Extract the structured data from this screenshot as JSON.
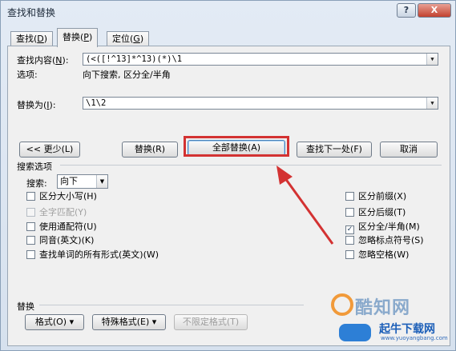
{
  "window": {
    "title": "查找和替换",
    "help_label": "?",
    "close_label": "X"
  },
  "tabs": [
    {
      "label": "查找",
      "key": "D"
    },
    {
      "label": "替换",
      "key": "P"
    },
    {
      "label": "定位",
      "key": "G"
    }
  ],
  "find": {
    "label": "查找内容",
    "key": "N",
    "value": "(<([!^13]*^13)(*)\\1",
    "options_label": "选项:",
    "options_value": "向下搜索, 区分全/半角"
  },
  "replace": {
    "label": "替换为",
    "key": "I",
    "value": "\\1\\2"
  },
  "buttons": {
    "less": "<< 更少(L)",
    "replace": "替换(R)",
    "replace_all": "全部替换(A)",
    "find_next": "查找下一处(F)",
    "cancel": "取消"
  },
  "search_options": {
    "title": "搜索选项",
    "search_label": "搜索:",
    "search_value": "向下",
    "left": [
      {
        "label": "区分大小写(H)",
        "checked": false,
        "disabled": false
      },
      {
        "label": "全字匹配(Y)",
        "checked": false,
        "disabled": true
      },
      {
        "label": "使用通配符(U)",
        "checked": false,
        "disabled": false
      },
      {
        "label": "同音(英文)(K)",
        "checked": false,
        "disabled": false
      },
      {
        "label": "查找单词的所有形式(英文)(W)",
        "checked": false,
        "disabled": false
      }
    ],
    "right": [
      {
        "label": "区分前缀(X)",
        "checked": false,
        "disabled": false
      },
      {
        "label": "区分后缀(T)",
        "checked": false,
        "disabled": false
      },
      {
        "label": "区分全/半角(M)",
        "checked": true,
        "disabled": false
      },
      {
        "label": "忽略标点符号(S)",
        "checked": false,
        "disabled": false
      },
      {
        "label": "忽略空格(W)",
        "checked": false,
        "disabled": false
      }
    ]
  },
  "replace_section": {
    "title": "替换",
    "format_label": "格式(O) ▾",
    "special_label": "特殊格式(E) ▾",
    "no_format_label": "不限定格式(T)"
  },
  "watermark": {
    "brand": "酷知网",
    "sub": "起牛下载网",
    "url": "www.yuoyangbang.com"
  },
  "colors": {
    "highlight_box": "#d33232",
    "arrow": "#d33232"
  },
  "check_mark": "✓"
}
